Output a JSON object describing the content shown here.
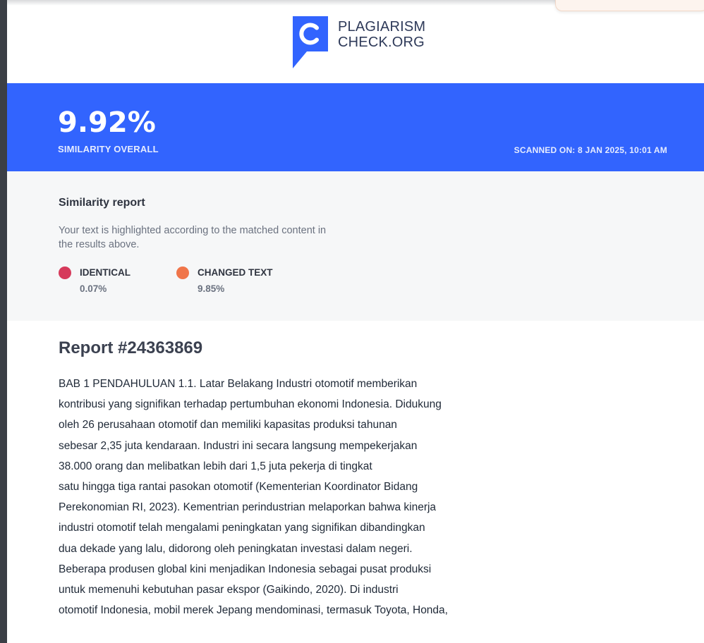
{
  "logo": {
    "line1": "PLAGIARISM",
    "line2": "CHECK.ORG",
    "icon": "plagiarismcheck-logo-icon",
    "brand_color": "#2e3a59"
  },
  "summary": {
    "similarity_value": "9.92%",
    "similarity_label": "SIMILARITY OVERALL",
    "scanned_on": "SCANNED ON: 8 JAN 2025, 10:01 AM",
    "banner_color": "#3264fe"
  },
  "similarity_report": {
    "title": "Similarity report",
    "description": "Your text is highlighted according to the matched content in the results above.",
    "legend": [
      {
        "name": "IDENTICAL",
        "percent": "0.07%",
        "color": "#d63a5b"
      },
      {
        "name": "CHANGED TEXT",
        "percent": "9.85%",
        "color": "#f0754a"
      }
    ]
  },
  "report": {
    "title": "Report #24363869",
    "lines": [
      "BAB 1 PENDAHULUAN 1.1. Latar Belakang Industri otomotif memberikan",
      "kontribusi yang signifikan terhadap pertumbuhan ekonomi Indonesia. Didukung",
      "oleh 26 perusahaan otomotif dan memiliki kapasitas produksi tahunan",
      "sebesar 2,35 juta kendaraan. Industri ini secara langsung mempekerjakan",
      "38.000 orang dan melibatkan lebih dari 1,5 juta pekerja di tingkat",
      "satu hingga tiga rantai pasokan otomotif (Kementerian Koordinator Bidang",
      "Perekonomian RI, 2023). Kementrian perindustrian melaporkan bahwa kinerja",
      "industri otomotif telah mengalami peningkatan yang signifikan dibandingkan",
      "dua dekade yang lalu, didorong oleh peningkatan investasi dalam negeri.",
      "Beberapa produsen global kini menjadikan Indonesia sebagai pusat produksi",
      "untuk memenuhi kebutuhan pasar ekspor (Gaikindo, 2020). Di industri",
      "otomotif Indonesia, mobil merek Jepang mendominasi, termasuk Toyota, Honda,"
    ]
  }
}
